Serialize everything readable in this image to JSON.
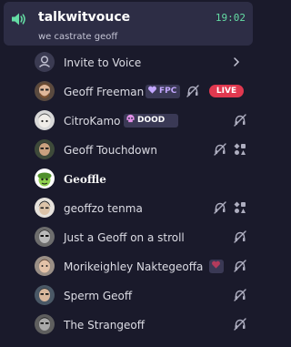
{
  "channel": {
    "name": "talkwitvouce",
    "time": "19:02",
    "topic": "we castrate geoff"
  },
  "invite": {
    "label": "Invite to Voice"
  },
  "members": [
    {
      "name": "Geoff Freeman",
      "tag": "FPC",
      "live": "LIVE",
      "status": [
        "deafened"
      ]
    },
    {
      "name": "CitroKamo",
      "tag": "DOOD",
      "status": [
        "deafened"
      ]
    },
    {
      "name": "Geoff Touchdown",
      "status": [
        "deafened",
        "activity"
      ]
    },
    {
      "name": "Geoffle",
      "status": []
    },
    {
      "name": "geoffzo tenma",
      "status": [
        "deafened",
        "activity"
      ]
    },
    {
      "name": "Just a Geoff on a stroll",
      "status": [
        "deafened"
      ]
    },
    {
      "name": "Morikeighley Naktegeoffa",
      "tag_icon": "heart-icon",
      "status": [
        "deafened"
      ]
    },
    {
      "name": "Sperm Geoff",
      "status": [
        "deafened"
      ]
    },
    {
      "name": "The Strangeoff",
      "status": [
        "deafened"
      ]
    }
  ],
  "colors": {
    "background": "#1a1a2b",
    "header": "#2d2d45",
    "time": "#64dca4",
    "live": "#e0384f",
    "fpc_tag": "#c3a7ff",
    "dood_tag": "#ffffff"
  }
}
